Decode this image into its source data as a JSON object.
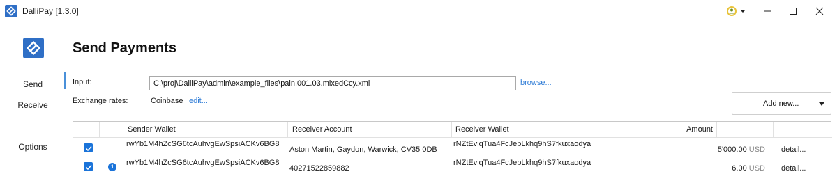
{
  "window": {
    "title": "DalliPay [1.3.0]",
    "user_icon": "user-avatar-icon",
    "min_icon": "minimize-icon",
    "max_icon": "maximize-icon",
    "close_icon": "close-icon"
  },
  "sidebar": {
    "items": [
      {
        "label": "Send"
      },
      {
        "label": "Receive"
      },
      {
        "label": "Options"
      }
    ]
  },
  "main": {
    "title": "Send Payments",
    "input_label": "Input:",
    "input_value": "C:\\proj\\DalliPay\\admin\\example_files\\pain.001.03.mixedCcy.xml",
    "browse_label": "browse...",
    "rates_label": "Exchange rates:",
    "rates_source": "Coinbase",
    "rates_edit": "edit...",
    "add_new_label": "Add new..."
  },
  "table": {
    "columns": [
      "Sender Wallet",
      "Receiver Account",
      "Receiver Wallet",
      "Amount"
    ],
    "rows": [
      {
        "checked": true,
        "info": false,
        "sender": "rwYb1M4hZcSG6tcAuhvgEwSpsiACKv6BG8",
        "receiver_account": "Aston Martin, Gaydon, Warwick, CV35 0DB",
        "receiver_wallet": "rNZtEviqTua4FcJebLkhq9hS7fkuxaodya",
        "amount": "5'000.00",
        "currency": "USD",
        "detail": "detail..."
      },
      {
        "checked": true,
        "info": true,
        "sender": "rwYb1M4hZcSG6tcAuhvgEwSpsiACKv6BG8",
        "receiver_account": "40271522859882",
        "receiver_wallet": "rNZtEviqTua4FcJebLkhq9hS7fkuxaodya",
        "amount": "6.00",
        "currency": "USD",
        "detail": "detail..."
      }
    ]
  },
  "colors": {
    "accent": "#1a73d9",
    "link": "#2d7bd6"
  }
}
